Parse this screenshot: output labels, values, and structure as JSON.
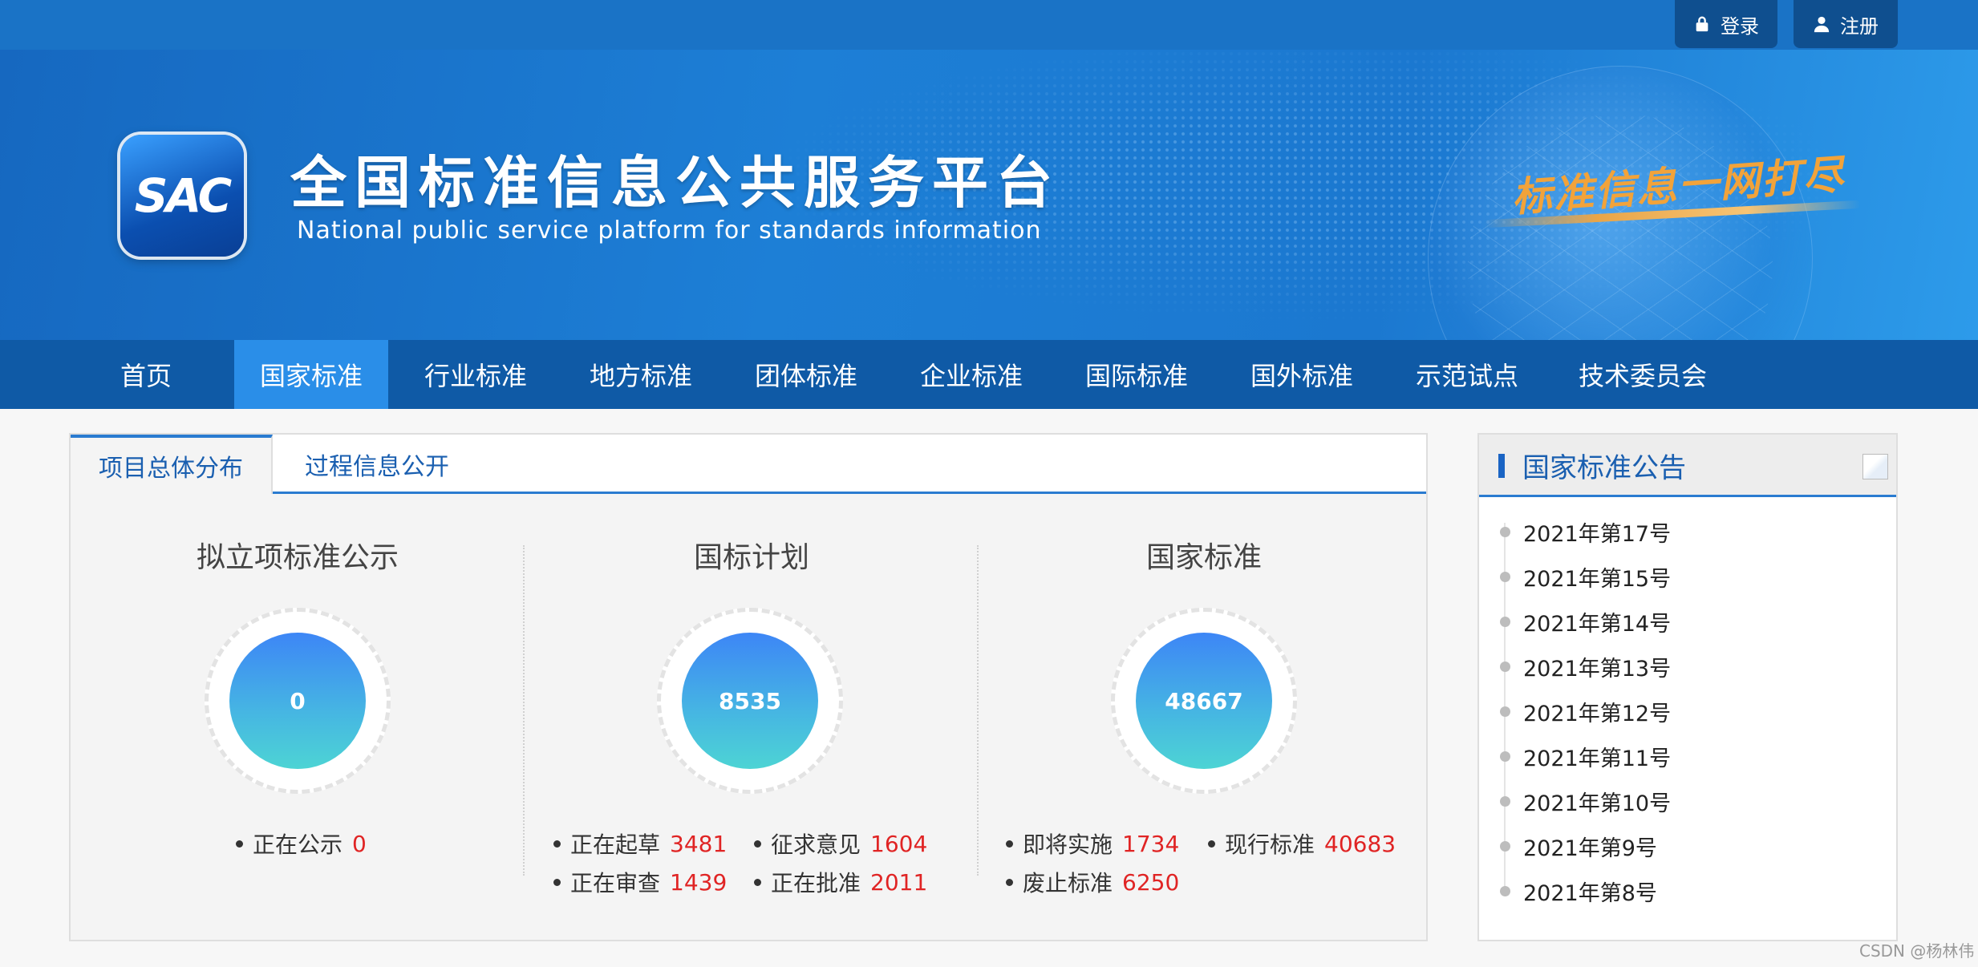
{
  "topbar": {
    "login_label": "登录",
    "register_label": "注册"
  },
  "banner": {
    "logo_text": "SAC",
    "title": "全国标准信息公共服务平台",
    "subtitle": "National public service platform  for standards information",
    "slogan": "标准信息一网打尽"
  },
  "nav": {
    "items": [
      {
        "label": "首页"
      },
      {
        "label": "国家标准"
      },
      {
        "label": "行业标准"
      },
      {
        "label": "地方标准"
      },
      {
        "label": "团体标准"
      },
      {
        "label": "企业标准"
      },
      {
        "label": "国际标准"
      },
      {
        "label": "国外标准"
      },
      {
        "label": "示范试点"
      },
      {
        "label": "技术委员会"
      }
    ],
    "active": "国家标准"
  },
  "overview": {
    "tabs": [
      {
        "label": "项目总体分布"
      },
      {
        "label": "过程信息公开"
      }
    ],
    "columns": [
      {
        "title": "拟立项标准公示",
        "total": "0",
        "stats": [
          {
            "label": "正在公示",
            "value": "0"
          }
        ]
      },
      {
        "title": "国标计划",
        "total": "8535",
        "stats": [
          {
            "label": "正在起草",
            "value": "3481"
          },
          {
            "label": "征求意见",
            "value": "1604"
          },
          {
            "label": "正在审查",
            "value": "1439"
          },
          {
            "label": "正在批准",
            "value": "2011"
          }
        ]
      },
      {
        "title": "国家标准",
        "total": "48667",
        "stats": [
          {
            "label": "即将实施",
            "value": "1734"
          },
          {
            "label": "现行标准",
            "value": "40683"
          },
          {
            "label": "废止标准",
            "value": "6250"
          }
        ]
      }
    ]
  },
  "announcements": {
    "title": "国家标准公告",
    "items": [
      {
        "label": "2021年第17号"
      },
      {
        "label": "2021年第15号"
      },
      {
        "label": "2021年第14号"
      },
      {
        "label": "2021年第13号"
      },
      {
        "label": "2021年第12号"
      },
      {
        "label": "2021年第11号"
      },
      {
        "label": "2021年第10号"
      },
      {
        "label": "2021年第9号"
      },
      {
        "label": "2021年第8号"
      }
    ]
  },
  "watermark": "CSDN @杨林伟",
  "colors": {
    "topbar": "#1a73c6",
    "nav": "#0f5aa6",
    "nav_active": "#2a8ee8",
    "accent": "#2a7bd0",
    "number": "#e02424"
  }
}
